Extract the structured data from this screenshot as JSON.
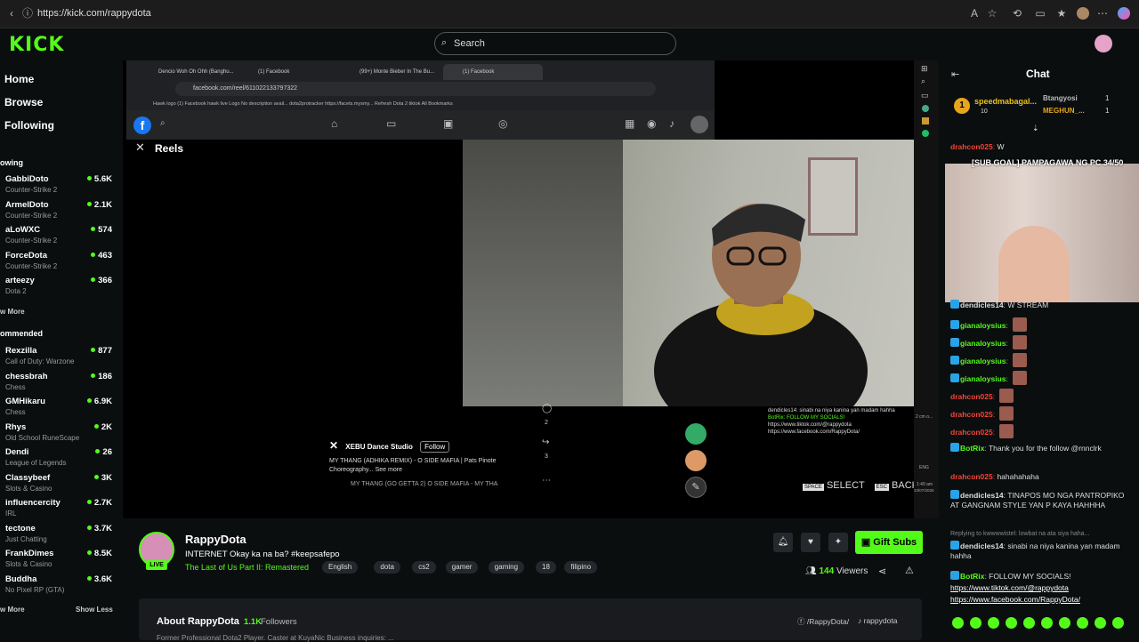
{
  "browser": {
    "url": "https://kick.com/rappydota"
  },
  "header": {
    "logo": "KICK",
    "search_placeholder": "Search"
  },
  "sidebar": {
    "nav": [
      "Home",
      "Browse",
      "Following"
    ],
    "following_title": "owing",
    "following": [
      {
        "name": "GabbiDoto",
        "game": "Counter-Strike 2",
        "viewers": "5.6K"
      },
      {
        "name": "ArmelDoto",
        "game": "Counter-Strike 2",
        "viewers": "2.1K"
      },
      {
        "name": "aLoWXC",
        "game": "Counter-Strike 2",
        "viewers": "574"
      },
      {
        "name": "ForceDota",
        "game": "Counter-Strike 2",
        "viewers": "463"
      },
      {
        "name": "arteezy",
        "game": "Dota 2",
        "viewers": "366"
      }
    ],
    "show_more_1": "w More",
    "recommended_title": "ommended",
    "recommended": [
      {
        "name": "Rexzilla",
        "game": "Call of Duty: Warzone",
        "viewers": "877"
      },
      {
        "name": "chessbrah",
        "game": "Chess",
        "viewers": "186"
      },
      {
        "name": "GMHikaru",
        "game": "Chess",
        "viewers": "6.9K"
      },
      {
        "name": "Rhys",
        "game": "Old School RuneScape",
        "viewers": "2K"
      },
      {
        "name": "Dendi",
        "game": "League of Legends",
        "viewers": "26"
      },
      {
        "name": "Classybeef",
        "game": "Slots & Casino",
        "viewers": "3K"
      },
      {
        "name": "influencercity",
        "game": "IRL",
        "viewers": "2.7K"
      },
      {
        "name": "tectone",
        "game": "Just Chatting",
        "viewers": "3.7K"
      },
      {
        "name": "FrankDimes",
        "game": "Slots & Casino",
        "viewers": "8.5K"
      },
      {
        "name": "Buddha",
        "game": "No Pixel RP (GTA)",
        "viewers": "3.6K"
      }
    ],
    "show_more_2": "w More",
    "show_less": "Show Less"
  },
  "video": {
    "fb_tabs": [
      "Dencio Woh Oh Ohh (Banghu...",
      "(1) Facebook",
      "(99+) Monte Bieber In The Bu...",
      "(1) Facebook"
    ],
    "fb_url": "facebook.com/reel/611022133797322",
    "fb_bookmarks": "Hawk logo    (1) Facebook    hawk live    Logo    No description avail...    dota2protracker    https://facets.mysmy...    Refresh    Dota 2    tiktok    All Bookmarks",
    "reels_label": "Reels",
    "reel_author": "XEBU Dance Studio",
    "reel_follow": "Follow",
    "reel_caption": "MY THANG (ADHIKA REMIX) - O SIDE MAFIA | Pats Pinote Choreography... See more",
    "reel_music": "MY THANG (GO GETTA 2)      O SIDE MAFIA - MY THA",
    "reel_like_count": "2",
    "reel_share_count": "3",
    "overlay_chat": [
      "dendicles14: sinabi na niya kanina yan madam hahha",
      "BotRix: FOLLOW MY SOCIALS!",
      "https://www.tiktok.com/@rappydota",
      "https://www.facebook.com/RappyDota/"
    ],
    "ctrl_select": "SELECT",
    "ctrl_back": "BACK",
    "ctrl_space": "SPACE",
    "ctrl_esc": "ESC",
    "clock_time": "1:49 am",
    "clock_date": "23/07/2025",
    "lang": "ENG",
    "weather": "2 cm o..."
  },
  "stream": {
    "name": "RappyDota",
    "live": "LIVE",
    "title": "INTERNET Okay ka na ba? #keepsafepo",
    "game": "The Last of Us Part II: Remastered",
    "tags": [
      "English",
      "dota",
      "cs2",
      "gamer",
      "gaming",
      "18",
      "filipino"
    ],
    "gift_label": "Gift Subs",
    "viewers_count": "144",
    "viewers_label": "Viewers",
    "about_label": "About RappyDota",
    "followers_count": "1.1K",
    "followers_label": "Followers",
    "social_fb": "/RappyDota/",
    "social_tiktok": "rappydota",
    "about_text": "Former Professional Dota2 Player. Caster at KuyaNic Business inquiries: ..."
  },
  "chat": {
    "title": "Chat",
    "top_gifters": [
      {
        "name": "speedmabagal...",
        "count": "10"
      },
      {
        "name": "Btangyosi",
        "count": "1"
      },
      {
        "name": "MEGHUN_...",
        "count": "1"
      }
    ],
    "cam_overlay": "[SUB GOAL] PAMPAGAWA NG PC 34/50",
    "messages": [
      {
        "user": "drahcon025",
        "text": "W",
        "color": "#f44336"
      },
      {
        "user": "dendicles14",
        "text": "W STREAM",
        "color": "#dddddd"
      },
      {
        "user": "gianaloysius",
        "text": "",
        "color": "#53fc18"
      },
      {
        "user": "gianaloysius",
        "text": "",
        "color": "#53fc18"
      },
      {
        "user": "gianaloysius",
        "text": "",
        "color": "#53fc18"
      },
      {
        "user": "gianaloysius",
        "text": "",
        "color": "#53fc18"
      },
      {
        "user": "drahcon025",
        "text": "",
        "color": "#f44336"
      },
      {
        "user": "drahcon025",
        "text": "",
        "color": "#f44336"
      },
      {
        "user": "drahcon025",
        "text": "",
        "color": "#f44336"
      },
      {
        "user": "BotRix",
        "text": "Thank you for the follow @rnnclrk",
        "color": "#53fc18"
      },
      {
        "user": "drahcon025",
        "text": "hahahahaha",
        "color": "#f44336"
      },
      {
        "user": "dendicles14",
        "text": "TINAPOS MO NGA PANTROPIKO AT GANGNAM STYLE YAN P KAYA HAHHHA",
        "color": "#dddddd"
      },
      {
        "user": "dendicles14",
        "text": "sinabi na niya kanina yan madam hahha",
        "color": "#dddddd"
      },
      {
        "user": "BotRix",
        "text": "FOLLOW MY SOCIALS!",
        "color": "#53fc18"
      }
    ],
    "reply_note": "Replying to kwwwwistel: lowbat na ata siya haha...",
    "link_tiktok": "https://www.tiktok.com/@rappydota",
    "link_fb": "https://www.facebook.com/RappyDota/"
  },
  "colors": {
    "accent": "#53fc18",
    "bg": "#0b0e0f",
    "panel": "#191b1f"
  }
}
